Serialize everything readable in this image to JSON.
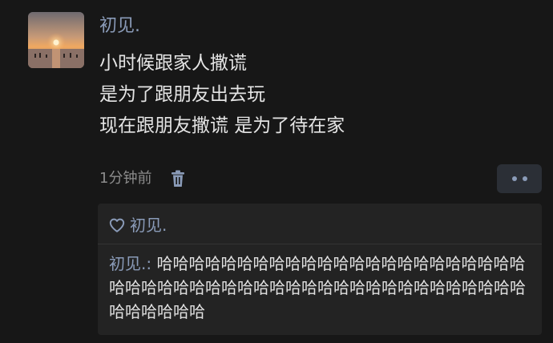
{
  "post": {
    "username": "初见.",
    "text_lines": [
      "小时候跟家人撒谎",
      "是为了跟朋友出去玩",
      "现在跟朋友撒谎 是为了待在家"
    ],
    "timestamp": "1分钟前",
    "delete_icon": "trash-icon",
    "more_icon": "more-dots-icon"
  },
  "interactions": {
    "like_icon": "heart-outline-icon",
    "likes": [
      "初见."
    ],
    "comments": [
      {
        "author": "初见.",
        "separator": ": ",
        "text": "哈哈哈哈哈哈哈哈哈哈哈哈哈哈哈哈哈哈哈哈哈哈哈哈哈哈哈哈哈哈哈哈哈哈哈哈哈哈哈哈哈哈哈哈哈哈哈哈哈哈哈哈哈哈哈"
      }
    ]
  },
  "colors": {
    "background": "#171717",
    "name_accent": "#8a9bb8",
    "primary_text": "#e4e4e4",
    "secondary_text": "#8c8c8c",
    "panel": "#232323",
    "button_bg": "#2b2f36"
  }
}
